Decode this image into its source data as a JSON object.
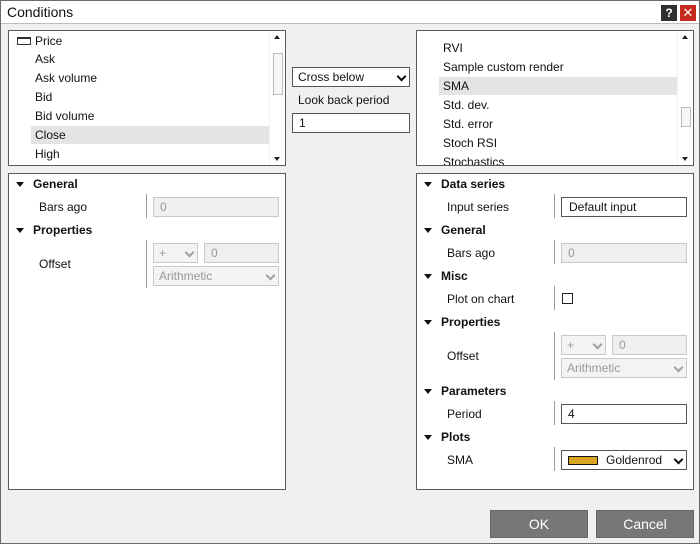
{
  "window": {
    "title": "Conditions",
    "help_glyph": "?",
    "close_glyph": "✕"
  },
  "left_list": {
    "items": [
      "Price",
      "Ask",
      "Ask volume",
      "Bid",
      "Bid volume",
      "Close",
      "High"
    ],
    "selected": "Close"
  },
  "middle": {
    "operator": "Cross below",
    "lookback_label": "Look back period",
    "lookback_value": "1"
  },
  "right_list": {
    "items": [
      "RVI",
      "Sample custom render",
      "SMA",
      "Std. dev.",
      "Std. error",
      "Stoch RSI",
      "Stochastics"
    ],
    "selected": "SMA"
  },
  "left_props": {
    "general": "General",
    "bars_ago_label": "Bars ago",
    "bars_ago_value": "0",
    "properties": "Properties",
    "offset_label": "Offset",
    "offset_sign": "+",
    "offset_value": "0",
    "offset_type": "Arithmetic"
  },
  "right_props": {
    "data_series": "Data series",
    "input_series_label": "Input series",
    "input_series_value": "Default input",
    "general": "General",
    "bars_ago_label": "Bars ago",
    "bars_ago_value": "0",
    "misc": "Misc",
    "plot_on_chart_label": "Plot on chart",
    "plot_on_chart_checked": false,
    "properties": "Properties",
    "offset_label": "Offset",
    "offset_sign": "+",
    "offset_value": "0",
    "offset_type": "Arithmetic",
    "parameters": "Parameters",
    "period_label": "Period",
    "period_value": "4",
    "plots": "Plots",
    "sma_label": "SMA",
    "sma_color_name": "Goldenrod",
    "sma_color": "#DAA520"
  },
  "buttons": {
    "ok": "OK",
    "cancel": "Cancel"
  }
}
